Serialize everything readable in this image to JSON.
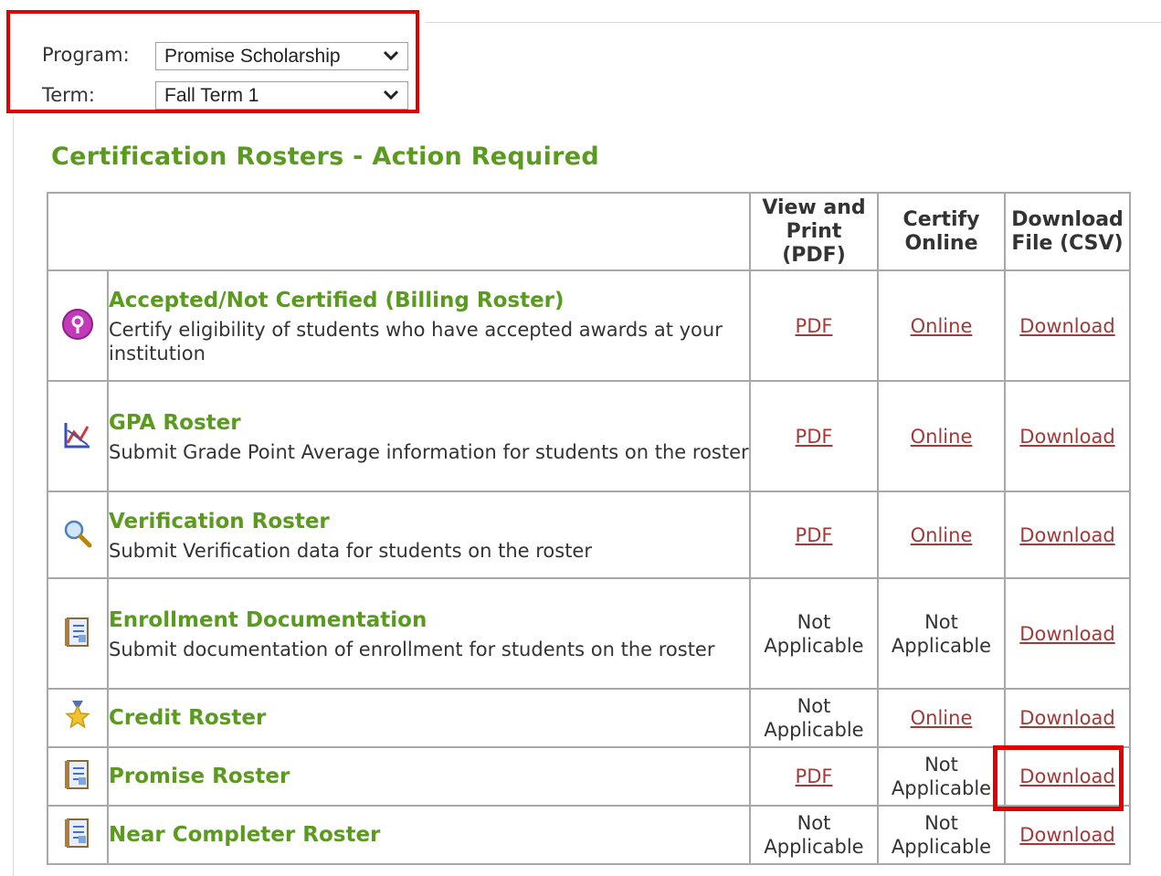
{
  "filters": {
    "program_label": "Program:",
    "program_value": "Promise Scholarship",
    "term_label": "Term:",
    "term_value": "Fall Term 1"
  },
  "section_title": "Certification Rosters - Action Required",
  "table": {
    "headers": {
      "pdf": "View and Print (PDF)",
      "online": "Certify Online",
      "csv": "Download File (CSV)"
    },
    "rows": [
      {
        "icon": "question-icon",
        "title": "Accepted/Not Certified (Billing Roster)",
        "desc": "Certify eligibility of students who have accepted awards at your institution",
        "pdf": "PDF",
        "online": "Online",
        "csv": "Download"
      },
      {
        "icon": "chart-icon",
        "title": "GPA Roster",
        "desc": "Submit Grade Point Average information for students on the roster",
        "pdf": "PDF",
        "online": "Online",
        "csv": "Download"
      },
      {
        "icon": "magnifier-icon",
        "title": "Verification Roster",
        "desc": "Submit Verification data for students on the roster",
        "pdf": "PDF",
        "online": "Online",
        "csv": "Download"
      },
      {
        "icon": "document-icon",
        "title": "Enrollment Documentation",
        "desc": "Submit documentation of enrollment for students on the roster",
        "pdf": "Not Applicable",
        "online": "Not Applicable",
        "csv": "Download"
      },
      {
        "icon": "star-medal-icon",
        "title": "Credit Roster",
        "desc": "",
        "pdf": "Not Applicable",
        "online": "Online",
        "csv": "Download"
      },
      {
        "icon": "document-icon",
        "title": "Promise Roster",
        "desc": "",
        "pdf": "PDF",
        "online": "Not Applicable",
        "csv": "Download"
      },
      {
        "icon": "document-icon",
        "title": "Near Completer Roster",
        "desc": "",
        "pdf": "Not Applicable",
        "online": "Not Applicable",
        "csv": "Download"
      }
    ]
  },
  "colors": {
    "accent_green": "#5a9a1f",
    "link": "#a33a3a",
    "highlight": "#e00000"
  }
}
